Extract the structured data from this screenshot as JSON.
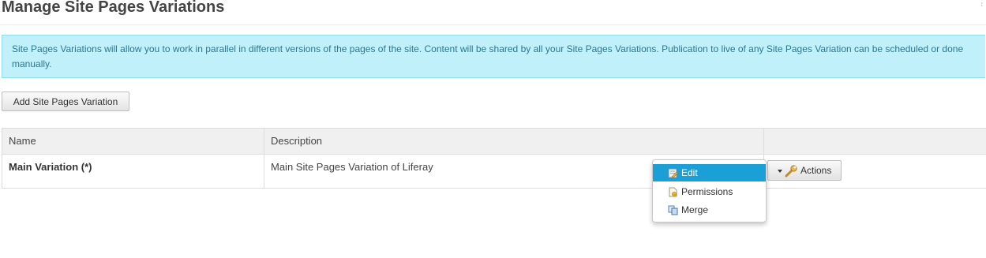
{
  "page": {
    "title": "Manage Site Pages Variations",
    "corner_mark": "↕"
  },
  "info": {
    "message": "Site Pages Variations will allow you to work in parallel in different versions of the pages of the site. Content will be shared by all your Site Pages Variations. Publication to live of any Site Pages Variation can be scheduled or done manually."
  },
  "toolbar": {
    "add_label": "Add Site Pages Variation"
  },
  "table": {
    "columns": [
      "Name",
      "Description",
      ""
    ],
    "rows": [
      {
        "name": "Main Variation (*)",
        "description": "Main Site Pages Variation of Liferay"
      }
    ]
  },
  "actions": {
    "label": "Actions",
    "icon": "wrench-icon",
    "menu": [
      {
        "label": "Edit",
        "icon": "edit-icon",
        "highlighted": true
      },
      {
        "label": "Permissions",
        "icon": "permissions-icon",
        "highlighted": false
      },
      {
        "label": "Merge",
        "icon": "merge-icon",
        "highlighted": false
      }
    ]
  },
  "colors": {
    "info_background": "#c0f0f9",
    "info_text": "#2a7891",
    "menu_highlight": "#1a9fd6"
  }
}
